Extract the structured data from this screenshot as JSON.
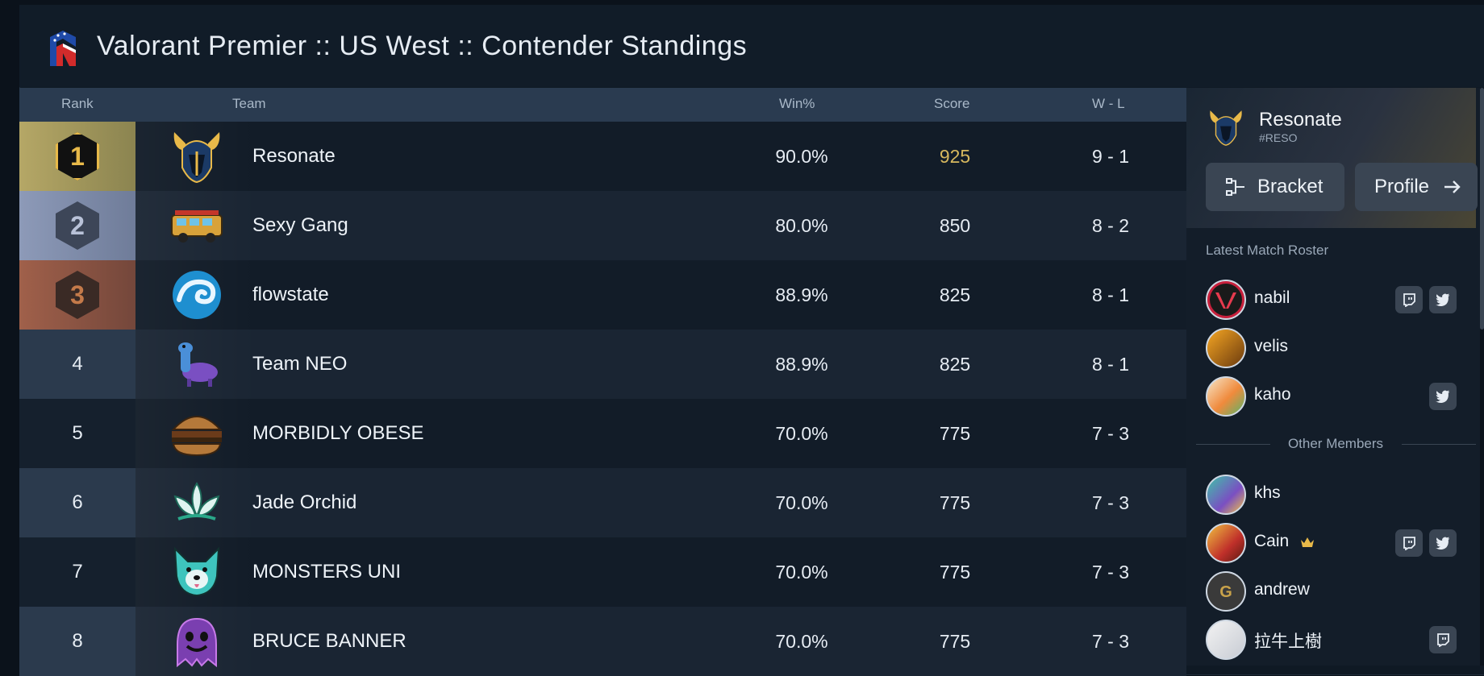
{
  "header": {
    "title": "Valorant Premier :: US West :: Contender Standings"
  },
  "table": {
    "columns": {
      "rank": "Rank",
      "team": "Team",
      "win": "Win%",
      "score": "Score",
      "wl": "W - L"
    },
    "rows": [
      {
        "rank": "1",
        "team": "Resonate",
        "win": "90.0%",
        "score": "925",
        "wl": "9 - 1",
        "logo": "horned-helmet-logo"
      },
      {
        "rank": "2",
        "team": "Sexy Gang",
        "win": "80.0%",
        "score": "850",
        "wl": "8 - 2",
        "logo": "jeepney-logo"
      },
      {
        "rank": "3",
        "team": "flowstate",
        "win": "88.9%",
        "score": "825",
        "wl": "8 - 1",
        "logo": "wave-logo"
      },
      {
        "rank": "4",
        "team": "Team NEO",
        "win": "88.9%",
        "score": "825",
        "wl": "8 - 1",
        "logo": "llama-logo"
      },
      {
        "rank": "5",
        "team": "MORBIDLY OBESE",
        "win": "70.0%",
        "score": "775",
        "wl": "7 - 3",
        "logo": "burger-logo"
      },
      {
        "rank": "6",
        "team": "Jade Orchid",
        "win": "70.0%",
        "score": "775",
        "wl": "7 - 3",
        "logo": "lotus-logo"
      },
      {
        "rank": "7",
        "team": "MONSTERS UNI",
        "win": "70.0%",
        "score": "775",
        "wl": "7 - 3",
        "logo": "dog-logo"
      },
      {
        "rank": "8",
        "team": "BRUCE BANNER",
        "win": "70.0%",
        "score": "775",
        "wl": "7 - 3",
        "logo": "ghost-logo"
      }
    ]
  },
  "sidebar": {
    "team_name": "Resonate",
    "team_tag": "#RESO",
    "bracket_label": "Bracket",
    "profile_label": "Profile",
    "latest_roster_label": "Latest Match Roster",
    "other_members_label": "Other Members",
    "latest_roster": [
      {
        "name": "nabil",
        "twitch": true,
        "twitter": true
      },
      {
        "name": "velis",
        "twitch": false,
        "twitter": false
      },
      {
        "name": "kaho",
        "twitch": false,
        "twitter": true
      }
    ],
    "other_members": [
      {
        "name": "khs",
        "twitch": false,
        "twitter": false
      },
      {
        "name": "Cain",
        "twitch": true,
        "twitter": true,
        "captain": true
      },
      {
        "name": "andrew",
        "twitch": false,
        "twitter": false
      },
      {
        "name": "拉牛上樹",
        "twitch": true,
        "twitter": false
      }
    ]
  },
  "colors": {
    "gold": "#e8b949",
    "score_highlight": "#d7b85e",
    "header_bg": "#2a3b50"
  }
}
